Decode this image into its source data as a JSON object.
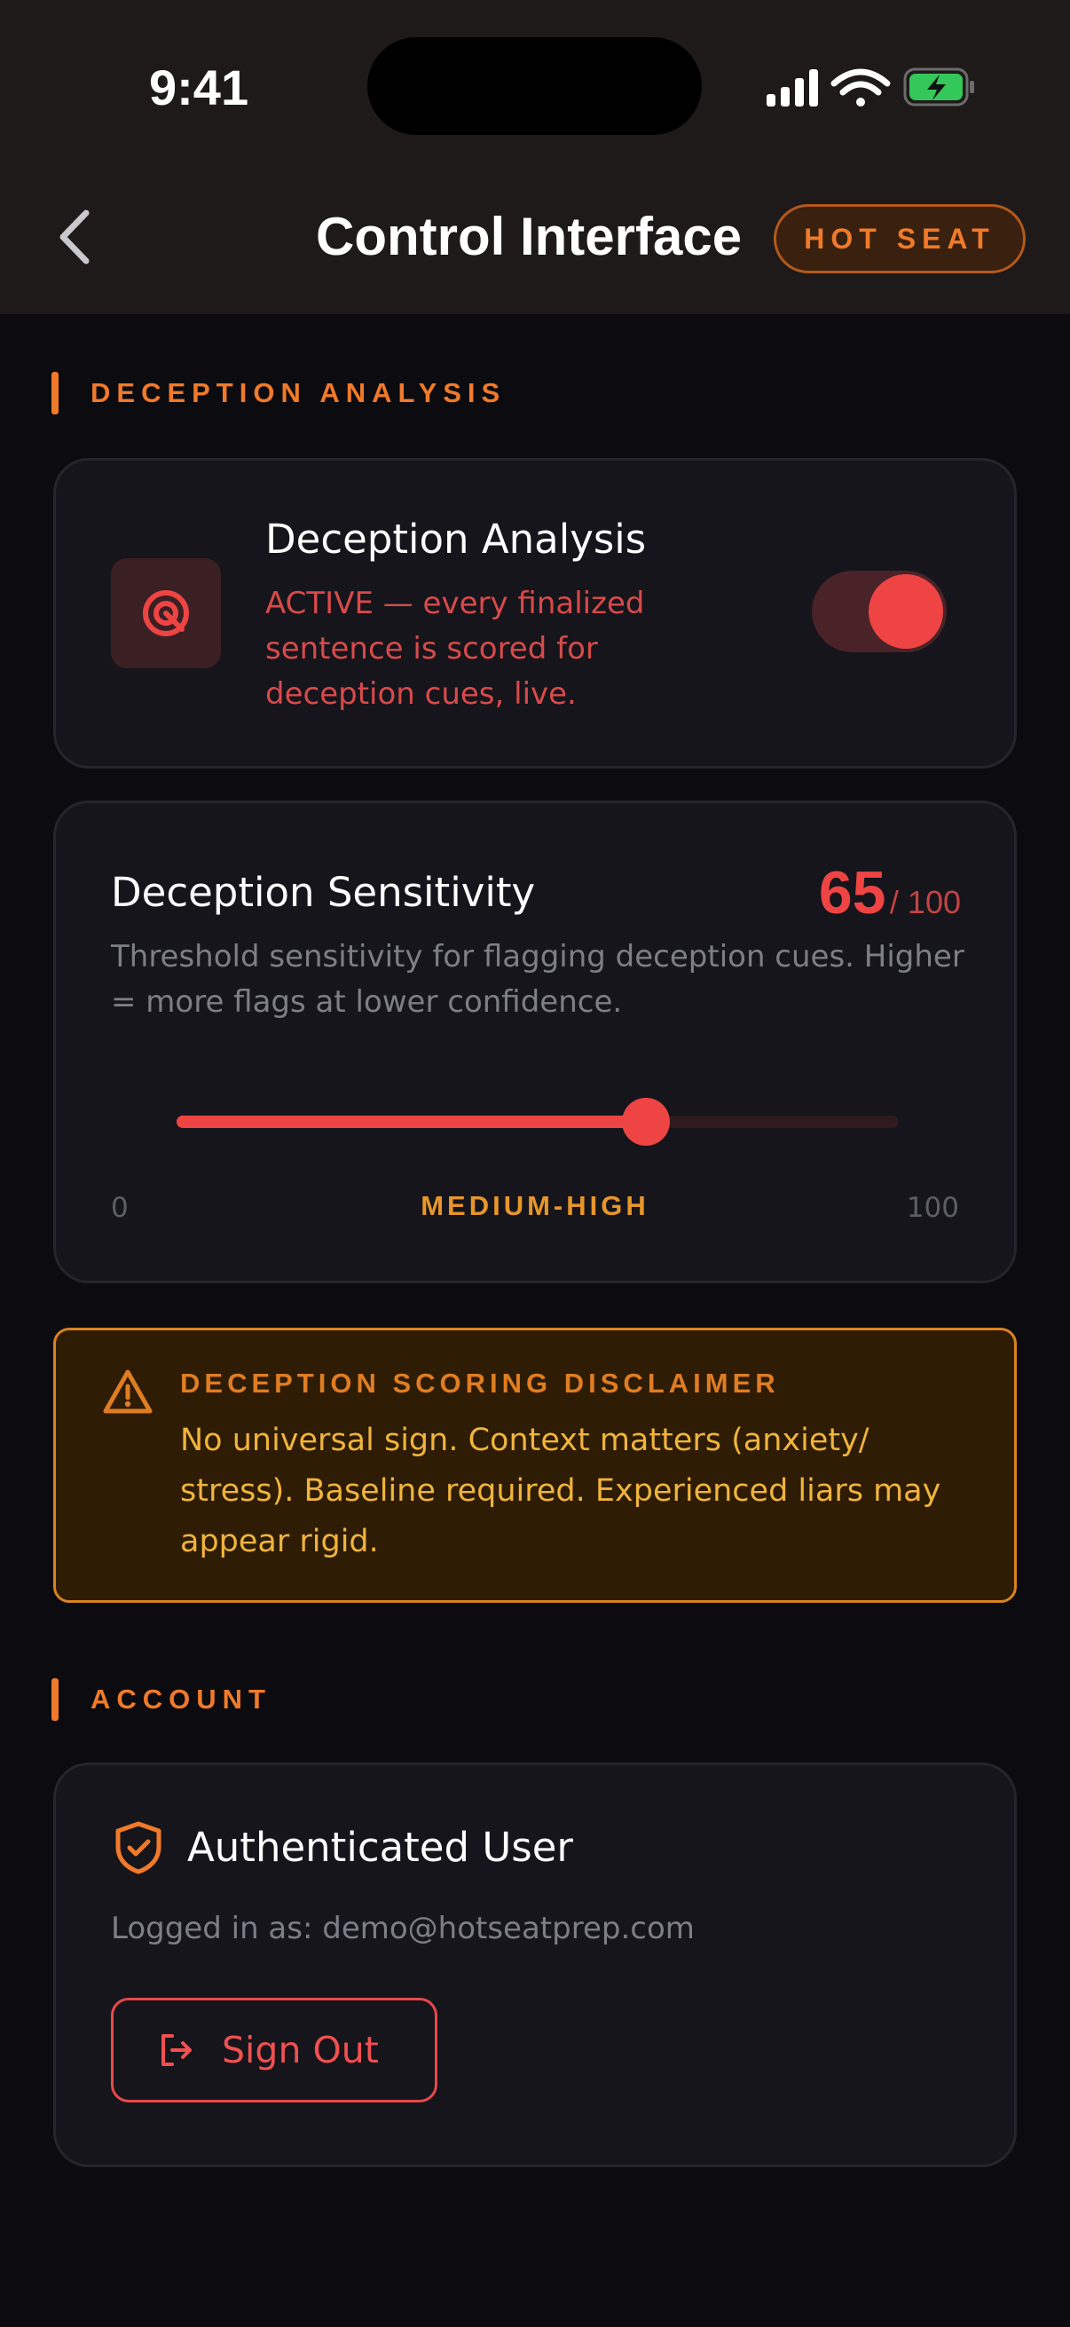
{
  "status_bar": {
    "time": "9:41",
    "icons": [
      "cellular-signal-icon",
      "wifi-icon",
      "battery-charging-icon"
    ],
    "battery_color": "#34c759"
  },
  "header": {
    "back_icon": "chevron-left-icon",
    "title": "Control Interface",
    "badge": "HOT SEAT"
  },
  "colors": {
    "accent_orange": "#f07a2a",
    "danger_red": "#ee4444",
    "warning_amber": "#e8962a",
    "background": "#0c0b0f",
    "card": "#15151b"
  },
  "sections": {
    "analysis_header": "DECEPTION ANALYSIS",
    "account_header": "ACCOUNT"
  },
  "analysis_card": {
    "icon": "target-icon",
    "title": "Deception Analysis",
    "status_text": "ACTIVE — every finalized sentence is scored for deception cues, live.",
    "toggle_on": true
  },
  "sensitivity_card": {
    "title": "Deception Sensitivity",
    "value": "65",
    "max_label": "/ 100",
    "value_fraction": 0.65,
    "description": "Threshold sensitivity for flagging deception cues. Higher = more flags at lower confidence.",
    "scale_min": "0",
    "scale_max": "100",
    "level_label": "MEDIUM-HIGH"
  },
  "disclaimer": {
    "icon": "warning-triangle-icon",
    "title": "DECEPTION SCORING DISCLAIMER",
    "body": "No universal sign. Context matters (anxiety/ stress). Baseline required. Experienced liars may appear rigid."
  },
  "account_card": {
    "icon": "shield-check-icon",
    "title": "Authenticated User",
    "logged_in_text": "Logged in as: demo@hotseatprep.com",
    "sign_out_icon": "sign-out-icon",
    "sign_out_label": "Sign Out"
  }
}
